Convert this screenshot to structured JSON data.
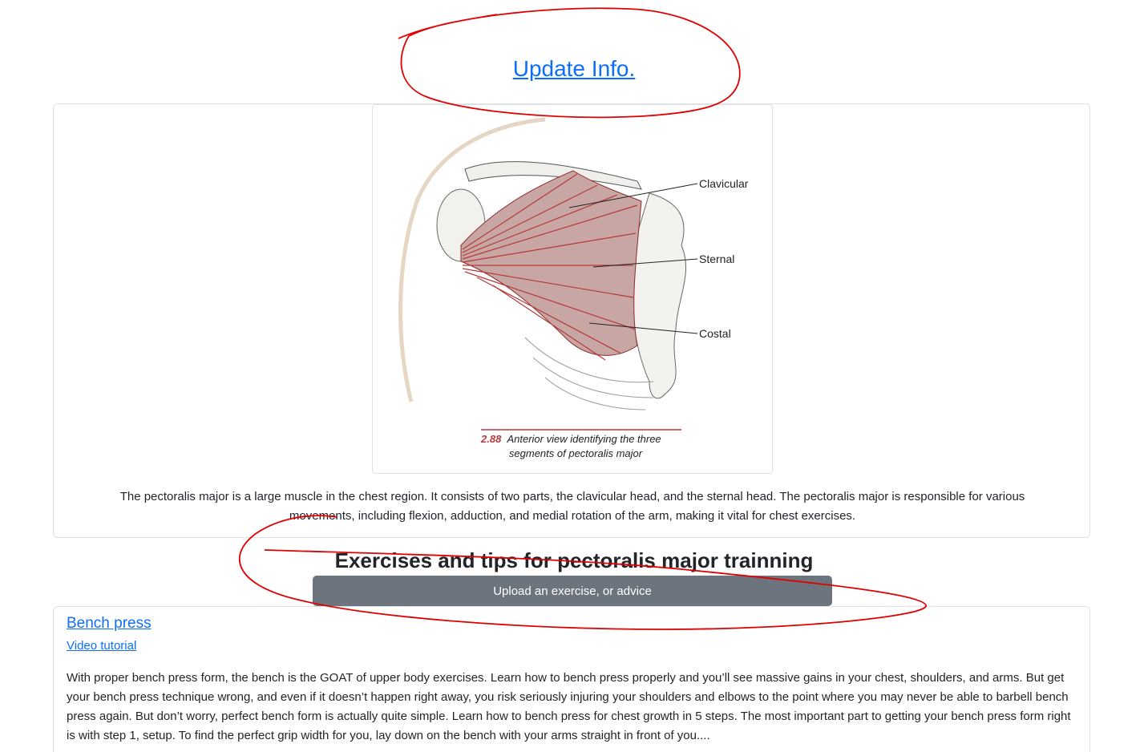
{
  "header": {
    "update_link": "Update Info."
  },
  "muscle": {
    "figure": {
      "labels": {
        "clavicular": "Clavicular",
        "sternal": "Sternal",
        "costal": "Costal"
      },
      "caption_number": "2.88",
      "caption_line1": "Anterior view identifying the three",
      "caption_line2": "segments of pectoralis major"
    },
    "description": "The pectoralis major is a large muscle in the chest region. It consists of two parts, the clavicular head, and the sternal head. The pectoralis major is responsible for various movements, including flexion, adduction, and medial rotation of the arm, making it vital for chest exercises."
  },
  "exercises_section": {
    "title": "Exercises and tips for pectoralis major trainning",
    "upload_button": "Upload an exercise, or advice"
  },
  "exercises": [
    {
      "title": "Bench press",
      "video_link": "Video tutorial",
      "text": "With proper bench press form, the bench is the GOAT of upper body exercises. Learn how to bench press properly and you’ll see massive gains in your chest, shoulders, and arms. But get your bench press technique wrong, and even if it doesn’t happen right away, you risk seriously injuring your shoulders and elbows to the point where you may never be able to barbell bench press again. But don’t worry, perfect bench form is actually quite simple. Learn how to bench press for chest growth in 5 steps. The most important part to getting your bench press form right is with step 1, setup. To find the perfect grip width for you, lay down on the bench with your arms straight in front of you...."
    }
  ],
  "colors": {
    "link": "#0d6efd",
    "button": "#6c757d",
    "annotation": "#e00000",
    "muscle": "#b5393a"
  }
}
